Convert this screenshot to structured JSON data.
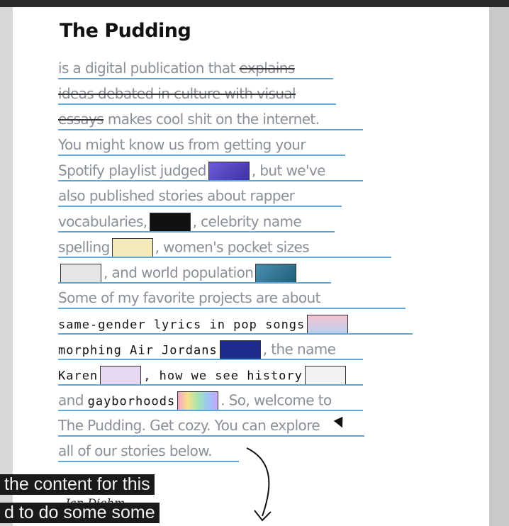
{
  "title": "The Pudding",
  "lines": [
    {
      "t1": "is a digital publication that ",
      "t2": "explains"
    },
    {
      "t1": "ideas debated in culture with visual"
    },
    {
      "t1": "essays",
      "t2": " makes cool shit on the internet."
    },
    {
      "t1": "You might know us from getting your"
    },
    {
      "t1": "Spotify playlist judged",
      "t2": ", but we've"
    },
    {
      "t1": "also published stories about rapper"
    },
    {
      "t1": "vocabularies,",
      "t2": ", celebrity name"
    },
    {
      "t1": "spelling",
      "t2": ", women's pocket sizes"
    },
    {
      "t1": "",
      "t2": ", and world population"
    },
    {
      "t1": "Some of my favorite projects are about"
    },
    {
      "t1": "same-gender lyrics in pop songs"
    },
    {
      "t1": "morphing Air Jordans",
      "t2": ", the name"
    },
    {
      "t1": "Karen",
      "t2": ", how we see history"
    },
    {
      "t1": "and ",
      "t2": "gayborhoods",
      "t3": ". So, welcome to"
    },
    {
      "t1": "The Pudding. Get cozy. You can explore"
    },
    {
      "t1": "all of our stories below."
    }
  ],
  "captions": [
    {
      "text": "the content for this"
    },
    {
      "text": "d to do some some"
    }
  ],
  "signature": "Jan Diehm",
  "colors": {
    "underline": "#5aa7d8",
    "text": "#8a8f98",
    "ink": "#111111"
  }
}
